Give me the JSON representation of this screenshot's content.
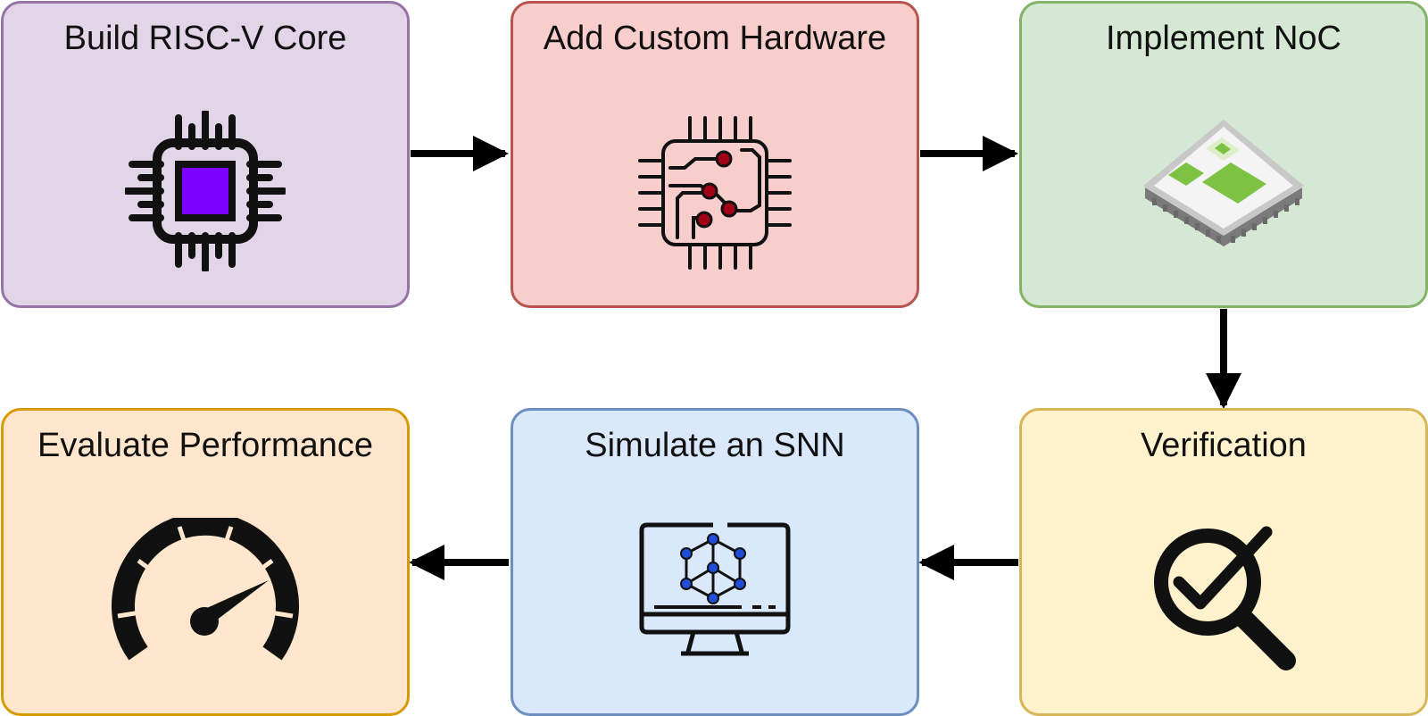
{
  "diagram": {
    "nodes": [
      {
        "id": "build-core",
        "title": "Build RISC-V Core",
        "icon": "cpu-chip-icon",
        "fill": "#e1d5e7",
        "stroke": "#9673a6"
      },
      {
        "id": "custom-hw",
        "title": "Add Custom Hardware",
        "icon": "circuit-chip-icon",
        "fill": "#f8cecc",
        "stroke": "#b85450"
      },
      {
        "id": "noc",
        "title": "Implement NoC",
        "icon": "soc-package-icon",
        "fill": "#d5e8d4",
        "stroke": "#82b366"
      },
      {
        "id": "verification",
        "title": "Verification",
        "icon": "magnifier-check-icon",
        "fill": "#fff2cc",
        "stroke": "#d6b656"
      },
      {
        "id": "simulate",
        "title": "Simulate an SNN",
        "icon": "monitor-network-icon",
        "fill": "#dae8fc",
        "stroke": "#6c8ebf"
      },
      {
        "id": "evaluate",
        "title": "Evaluate Performance",
        "icon": "speedometer-icon",
        "fill": "#ffe6cc",
        "stroke": "#d79b00"
      }
    ],
    "edges": [
      {
        "from": "build-core",
        "to": "custom-hw"
      },
      {
        "from": "custom-hw",
        "to": "noc"
      },
      {
        "from": "noc",
        "to": "verification"
      },
      {
        "from": "verification",
        "to": "simulate"
      },
      {
        "from": "simulate",
        "to": "evaluate"
      }
    ]
  }
}
